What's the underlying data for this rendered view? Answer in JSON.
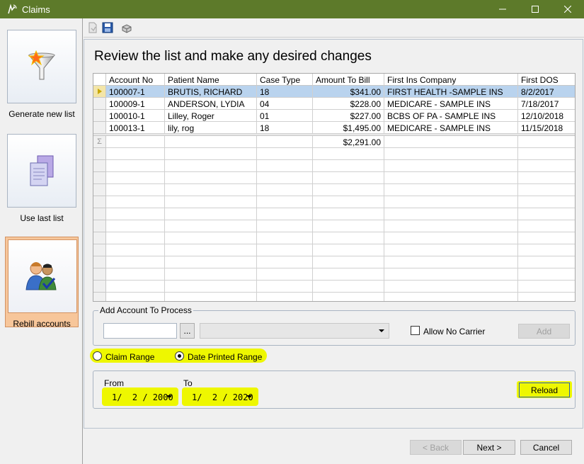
{
  "window": {
    "title": "Claims"
  },
  "nav": [
    {
      "label": "Generate new list",
      "icon": "funnel-icon",
      "active": false
    },
    {
      "label": "Use last list",
      "icon": "documents-icon",
      "active": false
    },
    {
      "label": "Rebill accounts",
      "icon": "users-check-icon",
      "active": true
    }
  ],
  "heading": "Review the list and make any desired changes",
  "grid": {
    "columns": [
      "Account No",
      "Patient Name",
      "Case Type",
      "Amount To Bill",
      "First Ins Company",
      "First DOS"
    ],
    "rows": [
      [
        "100007-1",
        "BRUTIS, RICHARD",
        "18",
        "$341.00",
        "FIRST HEALTH -SAMPLE INS",
        "8/2/2017"
      ],
      [
        "100009-1",
        "ANDERSON, LYDIA",
        "04",
        "$228.00",
        "MEDICARE - SAMPLE INS",
        "7/18/2017"
      ],
      [
        "100010-1",
        "Lilley, Roger",
        "01",
        "$227.00",
        "BCBS OF PA - SAMPLE INS",
        "12/10/2018"
      ],
      [
        "100013-1",
        "lily, rog",
        "18",
        "$1,495.00",
        "MEDICARE - SAMPLE INS",
        "11/15/2018"
      ]
    ],
    "summary_symbol": "Σ",
    "summary_total": "$2,291.00"
  },
  "add_account": {
    "title": "Add Account To Process",
    "browse_label": "...",
    "allow_no_carrier_label": "Allow No Carrier",
    "add_label": "Add"
  },
  "range": {
    "claim_range_label": "Claim Range",
    "date_printed_label": "Date Printed Range",
    "selected": "date_printed"
  },
  "dates": {
    "from_label": "From",
    "to_label": "To",
    "from_value": "1/  2 / 2000",
    "to_value": "1/  2 / 2020",
    "reload_label": "Reload"
  },
  "footer": {
    "back_label": "< Back",
    "next_label": "Next >",
    "cancel_label": "Cancel"
  },
  "colors": {
    "titlebar": "#5d7a2a",
    "highlight": "#eef700",
    "selection": "#b9d3ee",
    "active_nav": "#f7c69a"
  }
}
